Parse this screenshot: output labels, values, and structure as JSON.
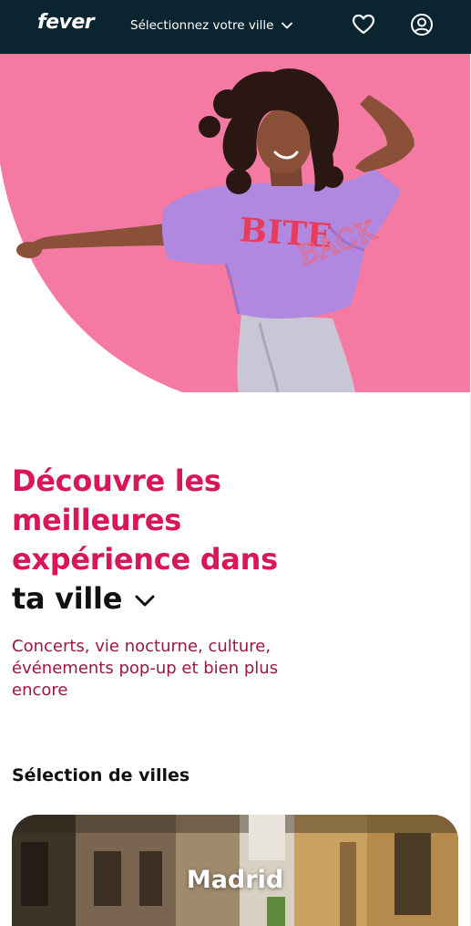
{
  "header": {
    "logo": "fever",
    "city_select_label": "Sélectionnez votre ville",
    "icons": [
      "heart-icon",
      "user-circle-icon",
      "chevron-down-icon"
    ]
  },
  "hero": {
    "shirt_text_1": "BITE",
    "shirt_text_2": "BACK"
  },
  "headline": {
    "line1": "Découvre les",
    "line2": "meilleures",
    "line3": "expérience dans",
    "city_line": "ta ville"
  },
  "subtitle": "Concerts, vie nocturne, culture, événements pop-up et bien plus encore",
  "cities_section": {
    "title": "Sélection de villes",
    "cards": [
      {
        "name": "Madrid"
      }
    ]
  },
  "colors": {
    "header_bg": "#0a2430",
    "accent_pink": "#d7175a",
    "hero_pink": "#f47aa4",
    "subtitle_color": "#9b1642"
  }
}
